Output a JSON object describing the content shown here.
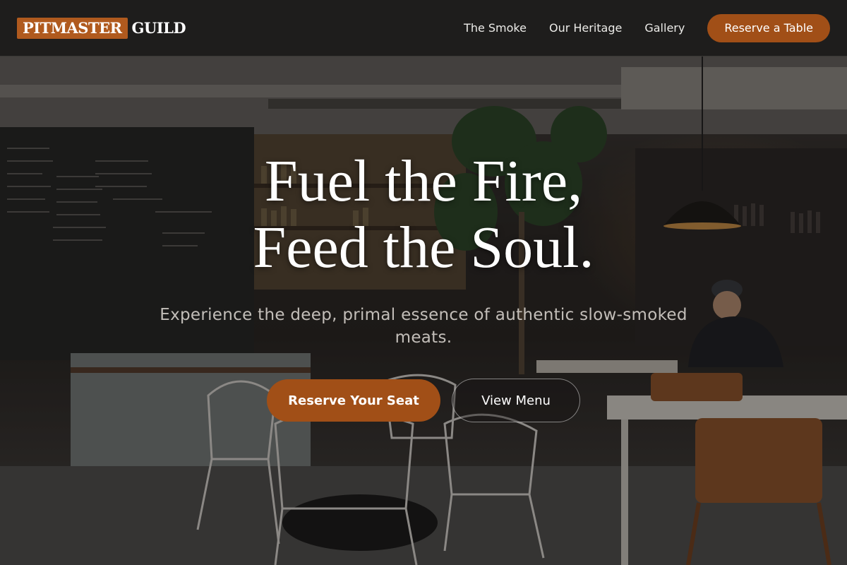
{
  "brand": {
    "logo_box_text": "PITMASTER",
    "logo_text": "GUILD",
    "accent_color": "#a14f17"
  },
  "nav": {
    "links": [
      {
        "label": "The Smoke"
      },
      {
        "label": "Our Heritage"
      },
      {
        "label": "Gallery"
      }
    ],
    "cta_label": "Reserve a Table"
  },
  "hero": {
    "headline_line1": "Fuel the Fire,",
    "headline_line2": "Feed the Soul.",
    "subtitle": "Experience the deep, primal essence of authentic slow-smoked meats.",
    "primary_button": "Reserve Your Seat",
    "secondary_button": "View Menu",
    "background_image": "cafe interior photo with chalkboard menu, pendant lamps, wicker chairs and a man at a laptop"
  }
}
